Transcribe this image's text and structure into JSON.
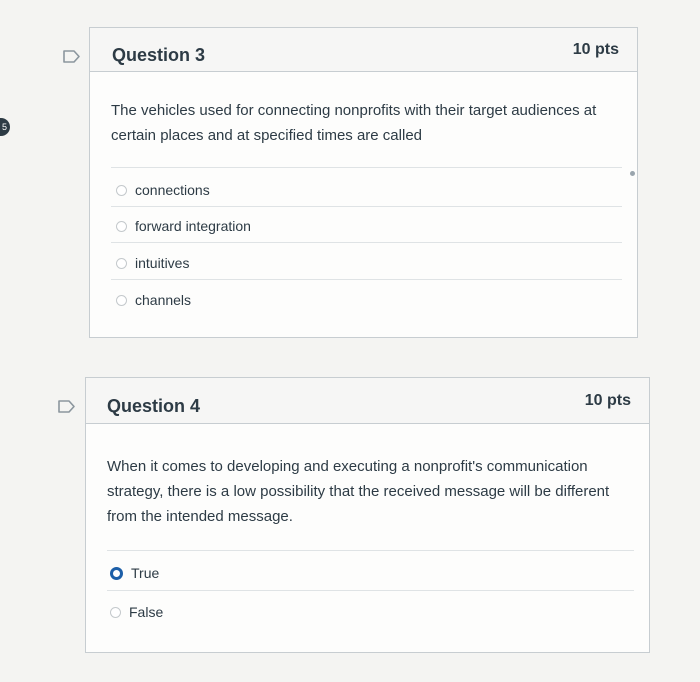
{
  "edge_badge": "5",
  "questions": [
    {
      "title": "Question 3",
      "points": "10 pts",
      "text": "The vehicles used for connecting nonprofits with their target audiences at certain places and at specified times are called",
      "answers": [
        {
          "label": "connections",
          "selected": false
        },
        {
          "label": "forward integration",
          "selected": false
        },
        {
          "label": "intuitives",
          "selected": false
        },
        {
          "label": "channels",
          "selected": false
        }
      ]
    },
    {
      "title": "Question 4",
      "points": "10 pts",
      "text": "When it comes to developing and executing a nonprofit's communication strategy, there is a low possibility that the received message will be different from the intended message.",
      "answers": [
        {
          "label": "True",
          "selected": true
        },
        {
          "label": "False",
          "selected": false
        }
      ]
    }
  ],
  "colors": {
    "accent": "#1d5fa8",
    "text": "#2d3b45",
    "border": "#c7cdd1"
  },
  "icons": {
    "flag": "flag-outline-icon",
    "radio": "radio-button-icon"
  }
}
